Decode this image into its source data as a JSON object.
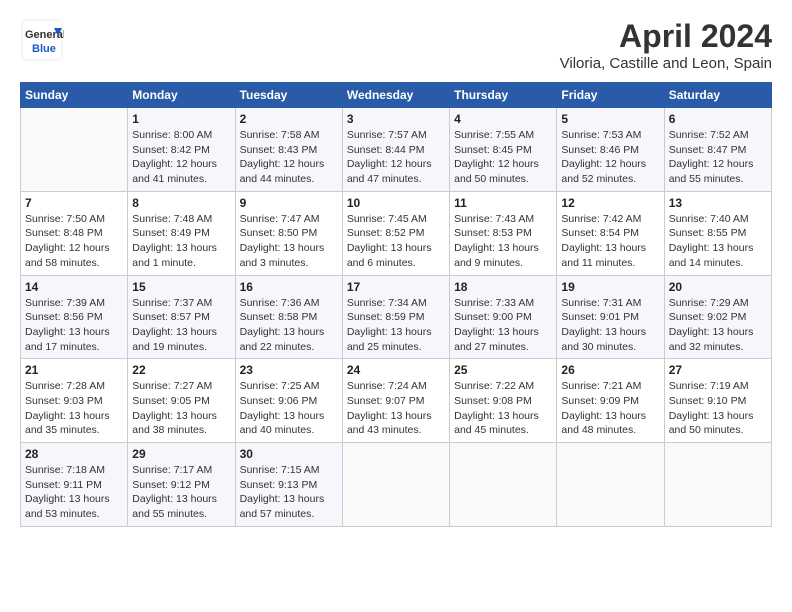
{
  "logo": {
    "line1": "General",
    "line2": "Blue"
  },
  "title": "April 2024",
  "subtitle": "Viloria, Castille and Leon, Spain",
  "header": {
    "days": [
      "Sunday",
      "Monday",
      "Tuesday",
      "Wednesday",
      "Thursday",
      "Friday",
      "Saturday"
    ]
  },
  "weeks": [
    [
      {
        "num": "",
        "info": ""
      },
      {
        "num": "1",
        "info": "Sunrise: 8:00 AM\nSunset: 8:42 PM\nDaylight: 12 hours\nand 41 minutes."
      },
      {
        "num": "2",
        "info": "Sunrise: 7:58 AM\nSunset: 8:43 PM\nDaylight: 12 hours\nand 44 minutes."
      },
      {
        "num": "3",
        "info": "Sunrise: 7:57 AM\nSunset: 8:44 PM\nDaylight: 12 hours\nand 47 minutes."
      },
      {
        "num": "4",
        "info": "Sunrise: 7:55 AM\nSunset: 8:45 PM\nDaylight: 12 hours\nand 50 minutes."
      },
      {
        "num": "5",
        "info": "Sunrise: 7:53 AM\nSunset: 8:46 PM\nDaylight: 12 hours\nand 52 minutes."
      },
      {
        "num": "6",
        "info": "Sunrise: 7:52 AM\nSunset: 8:47 PM\nDaylight: 12 hours\nand 55 minutes."
      }
    ],
    [
      {
        "num": "7",
        "info": "Sunrise: 7:50 AM\nSunset: 8:48 PM\nDaylight: 12 hours\nand 58 minutes."
      },
      {
        "num": "8",
        "info": "Sunrise: 7:48 AM\nSunset: 8:49 PM\nDaylight: 13 hours\nand 1 minute."
      },
      {
        "num": "9",
        "info": "Sunrise: 7:47 AM\nSunset: 8:50 PM\nDaylight: 13 hours\nand 3 minutes."
      },
      {
        "num": "10",
        "info": "Sunrise: 7:45 AM\nSunset: 8:52 PM\nDaylight: 13 hours\nand 6 minutes."
      },
      {
        "num": "11",
        "info": "Sunrise: 7:43 AM\nSunset: 8:53 PM\nDaylight: 13 hours\nand 9 minutes."
      },
      {
        "num": "12",
        "info": "Sunrise: 7:42 AM\nSunset: 8:54 PM\nDaylight: 13 hours\nand 11 minutes."
      },
      {
        "num": "13",
        "info": "Sunrise: 7:40 AM\nSunset: 8:55 PM\nDaylight: 13 hours\nand 14 minutes."
      }
    ],
    [
      {
        "num": "14",
        "info": "Sunrise: 7:39 AM\nSunset: 8:56 PM\nDaylight: 13 hours\nand 17 minutes."
      },
      {
        "num": "15",
        "info": "Sunrise: 7:37 AM\nSunset: 8:57 PM\nDaylight: 13 hours\nand 19 minutes."
      },
      {
        "num": "16",
        "info": "Sunrise: 7:36 AM\nSunset: 8:58 PM\nDaylight: 13 hours\nand 22 minutes."
      },
      {
        "num": "17",
        "info": "Sunrise: 7:34 AM\nSunset: 8:59 PM\nDaylight: 13 hours\nand 25 minutes."
      },
      {
        "num": "18",
        "info": "Sunrise: 7:33 AM\nSunset: 9:00 PM\nDaylight: 13 hours\nand 27 minutes."
      },
      {
        "num": "19",
        "info": "Sunrise: 7:31 AM\nSunset: 9:01 PM\nDaylight: 13 hours\nand 30 minutes."
      },
      {
        "num": "20",
        "info": "Sunrise: 7:29 AM\nSunset: 9:02 PM\nDaylight: 13 hours\nand 32 minutes."
      }
    ],
    [
      {
        "num": "21",
        "info": "Sunrise: 7:28 AM\nSunset: 9:03 PM\nDaylight: 13 hours\nand 35 minutes."
      },
      {
        "num": "22",
        "info": "Sunrise: 7:27 AM\nSunset: 9:05 PM\nDaylight: 13 hours\nand 38 minutes."
      },
      {
        "num": "23",
        "info": "Sunrise: 7:25 AM\nSunset: 9:06 PM\nDaylight: 13 hours\nand 40 minutes."
      },
      {
        "num": "24",
        "info": "Sunrise: 7:24 AM\nSunset: 9:07 PM\nDaylight: 13 hours\nand 43 minutes."
      },
      {
        "num": "25",
        "info": "Sunrise: 7:22 AM\nSunset: 9:08 PM\nDaylight: 13 hours\nand 45 minutes."
      },
      {
        "num": "26",
        "info": "Sunrise: 7:21 AM\nSunset: 9:09 PM\nDaylight: 13 hours\nand 48 minutes."
      },
      {
        "num": "27",
        "info": "Sunrise: 7:19 AM\nSunset: 9:10 PM\nDaylight: 13 hours\nand 50 minutes."
      }
    ],
    [
      {
        "num": "28",
        "info": "Sunrise: 7:18 AM\nSunset: 9:11 PM\nDaylight: 13 hours\nand 53 minutes."
      },
      {
        "num": "29",
        "info": "Sunrise: 7:17 AM\nSunset: 9:12 PM\nDaylight: 13 hours\nand 55 minutes."
      },
      {
        "num": "30",
        "info": "Sunrise: 7:15 AM\nSunset: 9:13 PM\nDaylight: 13 hours\nand 57 minutes."
      },
      {
        "num": "",
        "info": ""
      },
      {
        "num": "",
        "info": ""
      },
      {
        "num": "",
        "info": ""
      },
      {
        "num": "",
        "info": ""
      }
    ]
  ]
}
